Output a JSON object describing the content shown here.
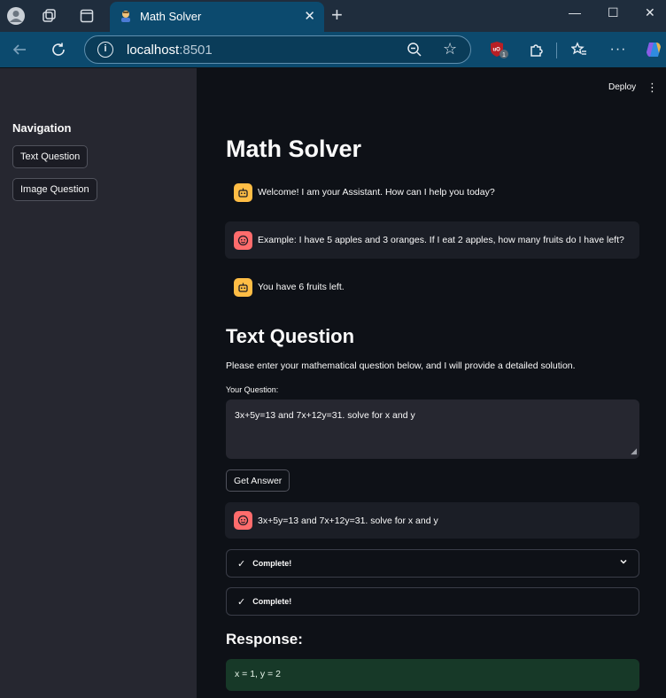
{
  "browser": {
    "tab_title": "Math Solver",
    "url_host": "localhost",
    "url_port": ":8501",
    "extension_badge": "1"
  },
  "sidebar": {
    "title": "Navigation",
    "buttons": [
      "Text Question",
      "Image Question"
    ]
  },
  "header": {
    "deploy_label": "Deploy"
  },
  "main": {
    "title": "Math Solver",
    "messages": [
      {
        "role": "assistant",
        "text": "Welcome! I am your Assistant. How can I help you today?"
      },
      {
        "role": "user",
        "text": "Example: I have 5 apples and 3 oranges. If I eat 2 apples, how many fruits do I have left?"
      },
      {
        "role": "assistant",
        "text": "You have 6 fruits left."
      }
    ],
    "section_title": "Text Question",
    "description": "Please enter your mathematical question below, and I will provide a detailed solution.",
    "input_label": "Your Question:",
    "input_value": "3x+5y=13 and 7x+12y=31. solve for x and y",
    "submit_label": "Get Answer",
    "user_question": "3x+5y=13 and 7x+12y=31. solve for x and y",
    "status_1": "Complete!",
    "status_2": "Complete!",
    "response_title": "Response:",
    "response_text": "x = 1, y = 2"
  },
  "colors": {
    "assistant_avatar": "#ffbd45",
    "user_avatar": "#ff6c6c",
    "response_bg": "#173928",
    "sidebar_bg": "#262730",
    "main_bg": "#0e1117"
  }
}
